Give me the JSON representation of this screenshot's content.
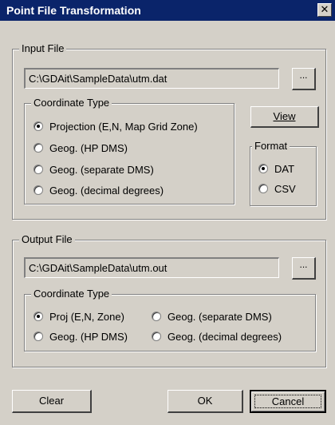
{
  "window": {
    "title": "Point File Transformation",
    "close_label": "✕"
  },
  "input_file": {
    "group_label": "Input File",
    "path": "C:\\GDAit\\SampleData\\utm.dat",
    "browse_label": "...",
    "view_label": "View",
    "coordinate_type": {
      "label": "Coordinate Type",
      "options": [
        {
          "label": "Projection (E,N,  Map Grid Zone)",
          "checked": true
        },
        {
          "label": "Geog. (HP DMS)",
          "checked": false
        },
        {
          "label": "Geog. (separate DMS)",
          "checked": false
        },
        {
          "label": "Geog. (decimal degrees)",
          "checked": false
        }
      ]
    },
    "format": {
      "label": "Format",
      "options": [
        {
          "label": "DAT",
          "checked": true
        },
        {
          "label": "CSV",
          "checked": false
        }
      ]
    }
  },
  "output_file": {
    "group_label": "Output File",
    "path": "C:\\GDAit\\SampleData\\utm.out",
    "browse_label": "...",
    "coordinate_type": {
      "label": "Coordinate Type",
      "options": [
        {
          "label": "Proj (E,N,  Zone)",
          "checked": true
        },
        {
          "label": "Geog. (separate DMS)",
          "checked": false
        },
        {
          "label": "Geog. (HP DMS)",
          "checked": false
        },
        {
          "label": "Geog. (decimal degrees)",
          "checked": false
        }
      ]
    }
  },
  "buttons": {
    "clear": "Clear",
    "ok": "OK",
    "cancel": "Cancel"
  }
}
